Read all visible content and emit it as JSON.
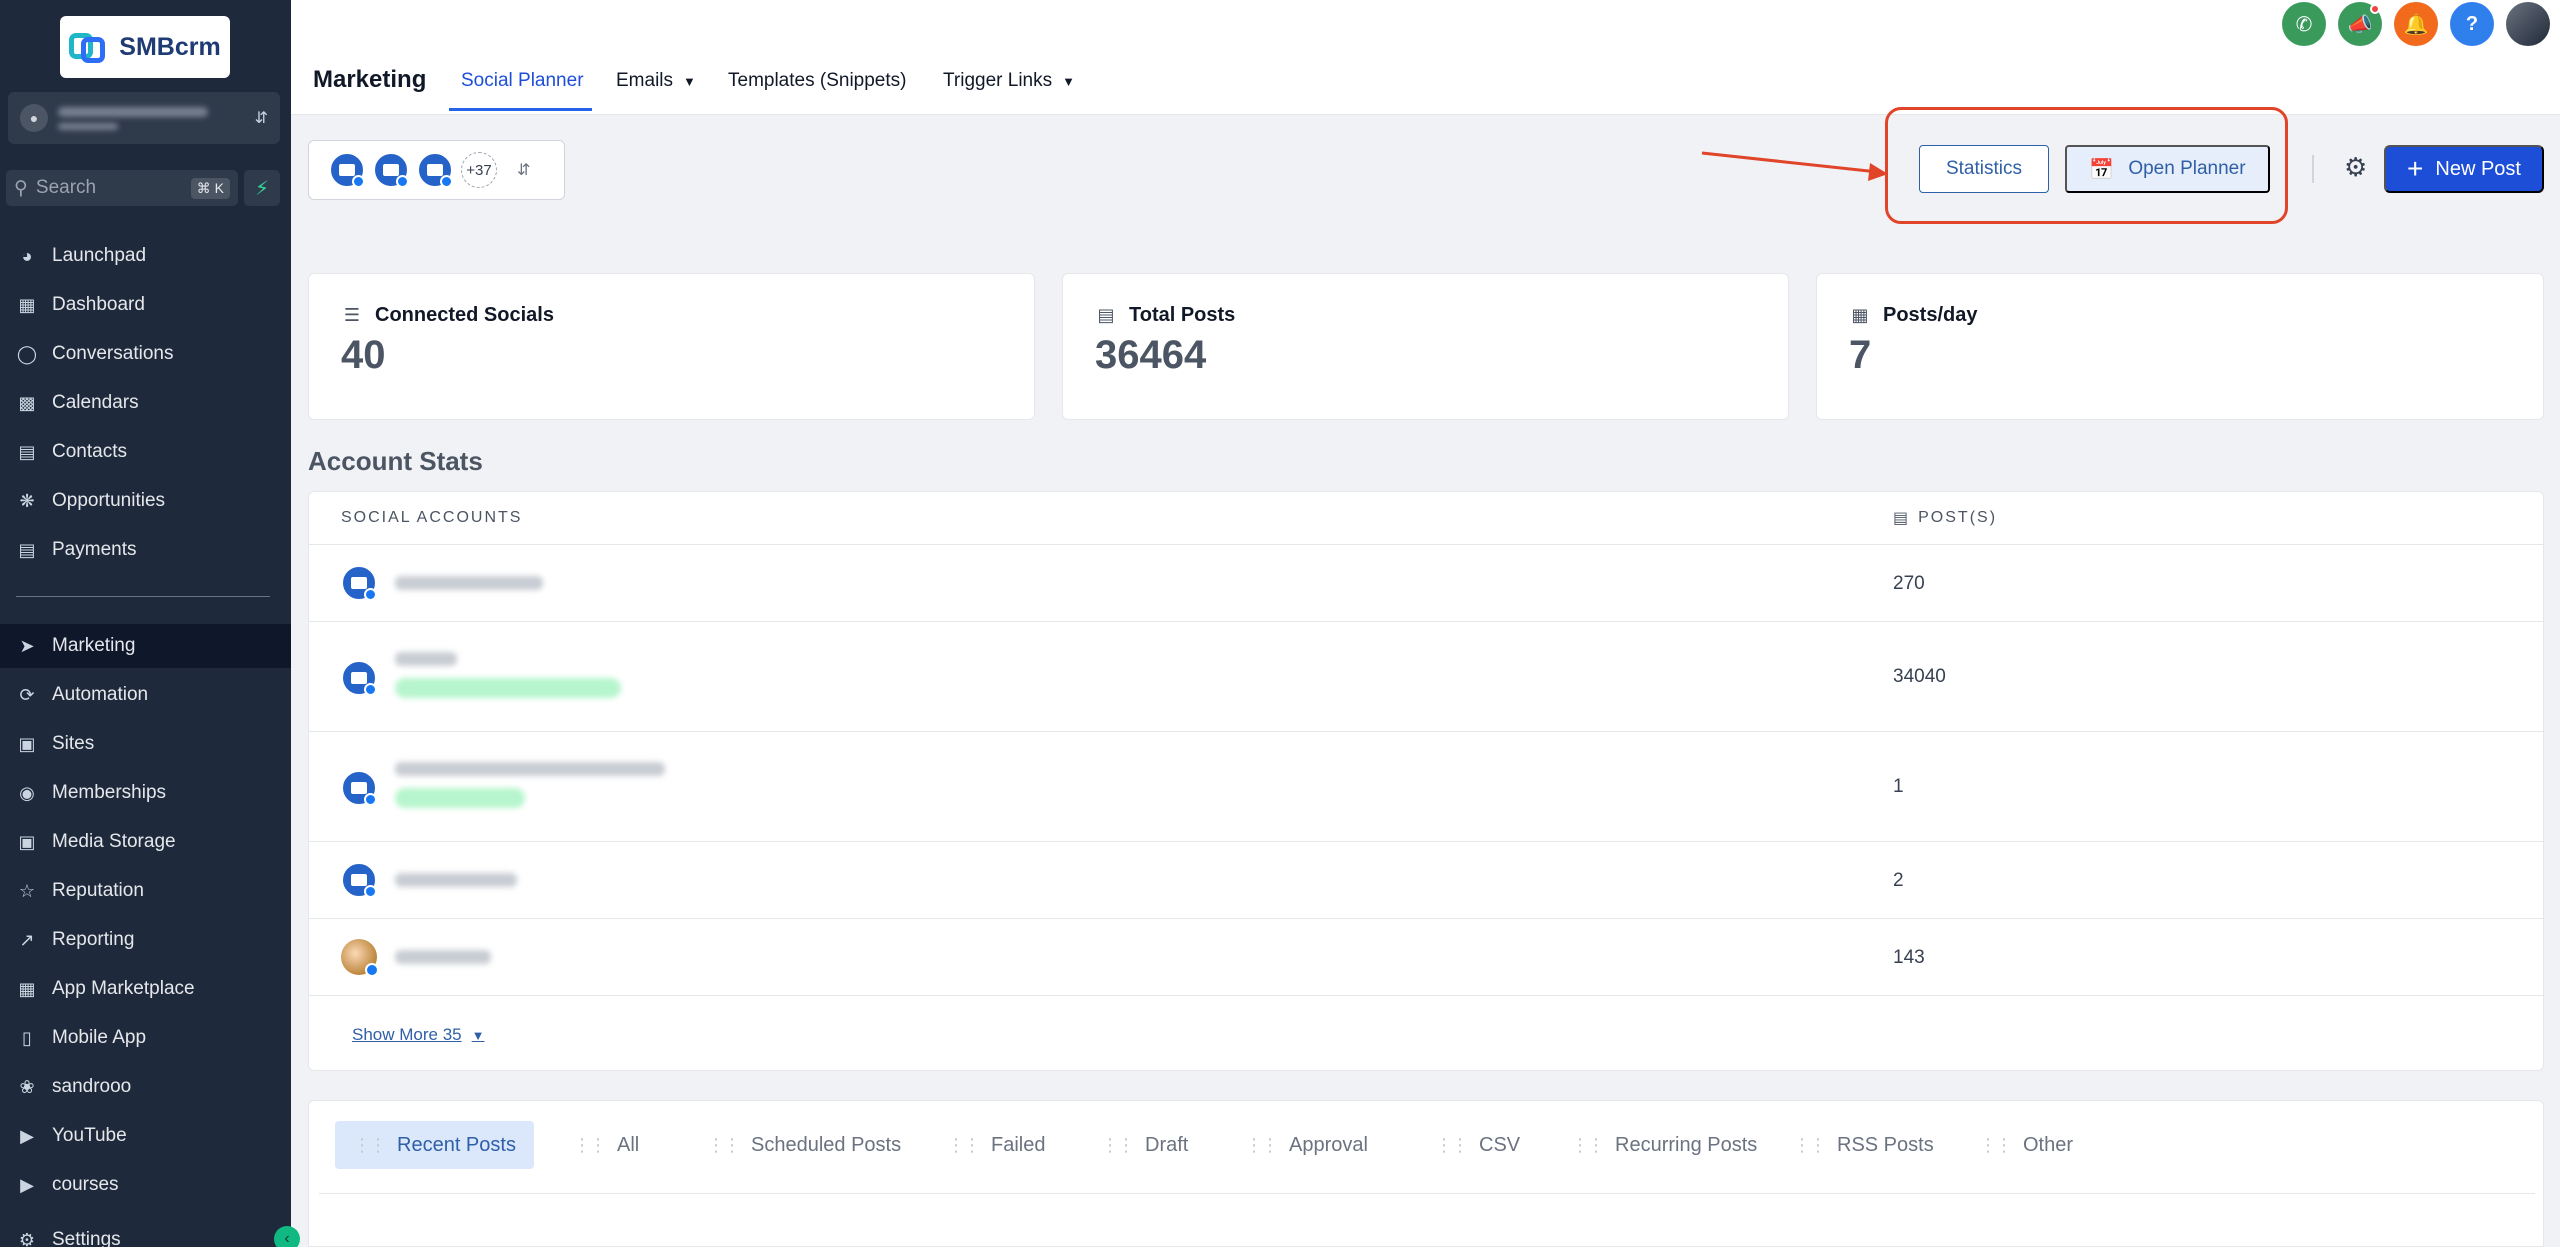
{
  "brand": {
    "name": "SMBcrm"
  },
  "sidebar": {
    "search_placeholder": "Search",
    "search_shortcut": "⌘ K",
    "items": [
      {
        "label": "Launchpad",
        "icon": "launchpad-icon"
      },
      {
        "label": "Dashboard",
        "icon": "dashboard-icon"
      },
      {
        "label": "Conversations",
        "icon": "chat-icon"
      },
      {
        "label": "Calendars",
        "icon": "calendar-icon"
      },
      {
        "label": "Contacts",
        "icon": "contacts-icon"
      },
      {
        "label": "Opportunities",
        "icon": "opportunities-icon"
      },
      {
        "label": "Payments",
        "icon": "payments-icon"
      },
      {
        "label": "Marketing",
        "icon": "send-icon",
        "active": true
      },
      {
        "label": "Automation",
        "icon": "automation-icon"
      },
      {
        "label": "Sites",
        "icon": "sites-icon"
      },
      {
        "label": "Memberships",
        "icon": "membership-icon"
      },
      {
        "label": "Media Storage",
        "icon": "image-icon"
      },
      {
        "label": "Reputation",
        "icon": "star-icon"
      },
      {
        "label": "Reporting",
        "icon": "trend-icon"
      },
      {
        "label": "App Marketplace",
        "icon": "apps-icon"
      },
      {
        "label": "Mobile App",
        "icon": "mobile-icon"
      },
      {
        "label": "sandrooo",
        "icon": "custom-link-icon"
      },
      {
        "label": "YouTube",
        "icon": "youtube-icon"
      },
      {
        "label": "courses",
        "icon": "youtube-icon"
      },
      {
        "label": "Settings",
        "icon": "gear-icon"
      }
    ]
  },
  "header": {
    "title": "Marketing",
    "tabs": [
      {
        "label": "Social Planner",
        "active": true
      },
      {
        "label": "Emails",
        "dropdown": true
      },
      {
        "label": "Templates (Snippets)"
      },
      {
        "label": "Trigger Links",
        "dropdown": true
      }
    ],
    "icon_colors": {
      "phone": "#3a9a5b",
      "megaphone": "#3a9a5b",
      "bell": "#f26b1d",
      "help": "#2f80ed"
    }
  },
  "account_selector": {
    "more_count": "+37"
  },
  "actions": {
    "statistics": "Statistics",
    "open_planner": "Open Planner",
    "new_post": "New Post"
  },
  "stats": {
    "connected_socials": {
      "label": "Connected Socials",
      "value": "40"
    },
    "total_posts": {
      "label": "Total Posts",
      "value": "36464"
    },
    "posts_per_day": {
      "label": "Posts/day",
      "value": "7"
    }
  },
  "account_stats": {
    "title": "Account Stats",
    "col_accounts": "SOCIAL ACCOUNTS",
    "col_posts": "POST(S)",
    "rows": [
      {
        "posts": "270"
      },
      {
        "posts": "34040"
      },
      {
        "posts": "1"
      },
      {
        "posts": "2"
      },
      {
        "posts": "143"
      }
    ],
    "show_more": "Show More 35"
  },
  "post_tabs": [
    "Recent Posts",
    "All",
    "Scheduled Posts",
    "Failed",
    "Draft",
    "Approval",
    "CSV",
    "Recurring Posts",
    "RSS Posts",
    "Other"
  ],
  "colors": {
    "sidebar": "#1e2a3b",
    "accent": "#1d4ed8",
    "highlight": "#e0452a"
  }
}
